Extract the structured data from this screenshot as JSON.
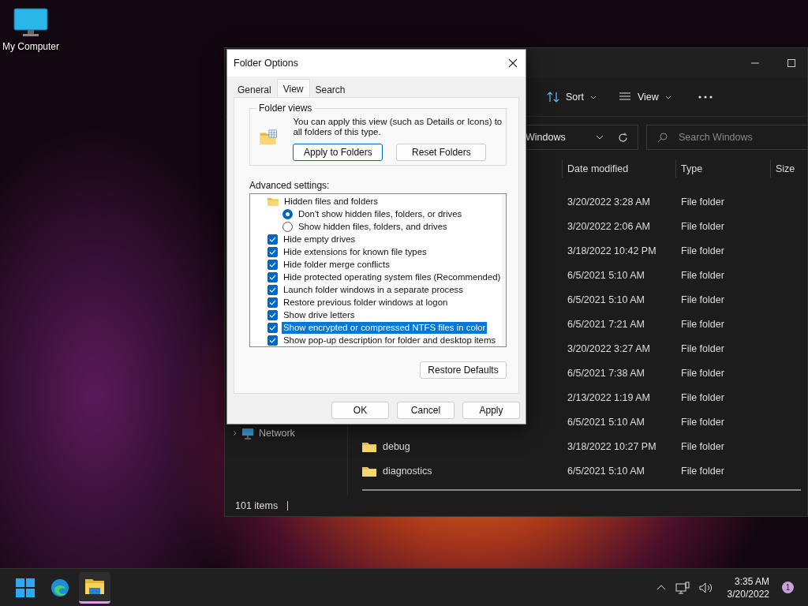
{
  "desktop_icons": [
    {
      "label": "My Computer"
    }
  ],
  "explorer": {
    "toolbar": [
      {
        "kind": "sort",
        "label": "Sort"
      },
      {
        "kind": "view",
        "label": "View"
      },
      {
        "kind": "more"
      }
    ],
    "address": "Windows",
    "search": {
      "placeholder": "Search Windows"
    },
    "columns": [
      "Date modified",
      "Type",
      "Size"
    ],
    "rows": [
      {
        "date": "3/20/2022 3:28 AM",
        "type": "File folder"
      },
      {
        "date": "3/20/2022 2:06 AM",
        "type": "File folder"
      },
      {
        "date": "3/18/2022 10:42 PM",
        "type": "File folder"
      },
      {
        "date": "6/5/2021 5:10 AM",
        "type": "File folder"
      },
      {
        "date": "6/5/2021 5:10 AM",
        "type": "File folder"
      },
      {
        "date": "6/5/2021 7:21 AM",
        "type": "File folder"
      },
      {
        "date": "3/20/2022 3:27 AM",
        "type": "File folder"
      },
      {
        "date": "6/5/2021 7:38 AM",
        "type": "File folder"
      },
      {
        "date": "2/13/2022 1:19 AM",
        "type": "File folder"
      },
      {
        "date": "6/5/2021 5:10 AM",
        "type": "File folder"
      },
      {
        "name": "debug",
        "date": "3/18/2022 10:27 PM",
        "type": "File folder"
      },
      {
        "name": "diagnostics",
        "date": "6/5/2021 5:10 AM",
        "type": "File folder"
      }
    ],
    "sidebar": [
      {
        "label": "Network"
      }
    ],
    "status_bar": "101 items"
  },
  "dialog": {
    "title": "Folder Options",
    "tabs": [
      {
        "label": "General",
        "selected": false
      },
      {
        "label": "View",
        "selected": true
      },
      {
        "label": "Search",
        "selected": false
      }
    ],
    "folder_views": {
      "title": "Folder views",
      "text": "You can apply this view (such as Details or Icons) to all folders of this type.",
      "buttons": [
        "Apply to Folders",
        "Reset Folders"
      ]
    },
    "advanced_label": "Advanced settings:",
    "settings": [
      {
        "kind": "folder",
        "label": "Hidden files and folders",
        "selected": false,
        "children": [
          {
            "kind": "radio",
            "label": "Don't show hidden files, folders, or drives",
            "checked": true,
            "selected": false
          },
          {
            "kind": "radio",
            "label": "Show hidden files, folders, and drives",
            "checked": false,
            "selected": false
          }
        ]
      },
      {
        "kind": "checkbox",
        "label": "Hide empty drives",
        "checked": true,
        "selected": false
      },
      {
        "kind": "checkbox",
        "label": "Hide extensions for known file types",
        "checked": true,
        "selected": false
      },
      {
        "kind": "checkbox",
        "label": "Hide folder merge conflicts",
        "checked": true,
        "selected": false
      },
      {
        "kind": "checkbox",
        "label": "Hide protected operating system files (Recommended)",
        "checked": true,
        "selected": false
      },
      {
        "kind": "checkbox",
        "label": "Launch folder windows in a separate process",
        "checked": true,
        "selected": false
      },
      {
        "kind": "checkbox",
        "label": "Restore previous folder windows at logon",
        "checked": true,
        "selected": false
      },
      {
        "kind": "checkbox",
        "label": "Show drive letters",
        "checked": true,
        "selected": false
      },
      {
        "kind": "checkbox",
        "label": "Show encrypted or compressed NTFS files in color",
        "checked": true,
        "selected": true
      },
      {
        "kind": "checkbox",
        "label": "Show pop-up description for folder and desktop items",
        "checked": true,
        "selected": false
      }
    ],
    "restore_button": "Restore Defaults",
    "buttons": [
      "OK",
      "Cancel",
      "Apply"
    ]
  },
  "taskbar": {
    "apps": [
      {
        "kind": "start",
        "selected": false
      },
      {
        "kind": "browser",
        "selected": false
      },
      {
        "kind": "explorer",
        "selected": true
      }
    ],
    "time": "3:35 AM",
    "date": "3/20/2022",
    "notifications": "1"
  }
}
